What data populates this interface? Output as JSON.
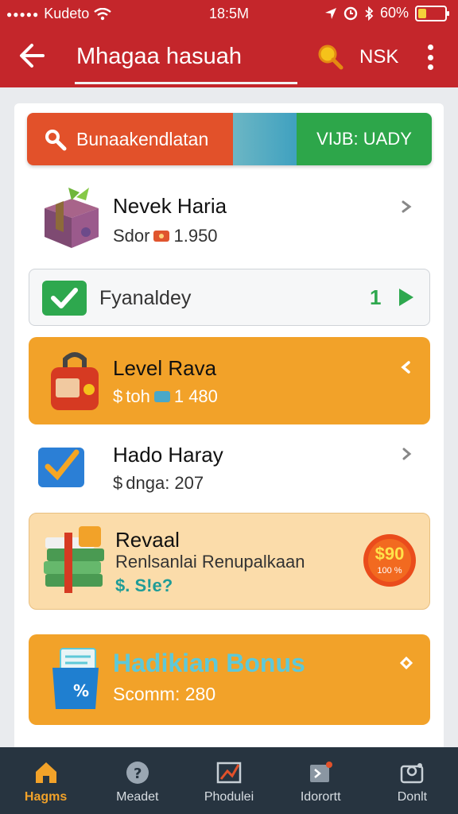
{
  "status_bar": {
    "carrier": "Kudeto",
    "time": "18:5M",
    "battery": "60%"
  },
  "header": {
    "title": "Mhagaa hasuah",
    "action_label": "NSK"
  },
  "top_bar": {
    "search_label": "Bunaakendlatan",
    "vip_label": "VIJB: UADY"
  },
  "items": [
    {
      "name": "Nevek Haria",
      "sub": "Sdor",
      "value": "1.950"
    },
    {
      "label": "Fyanaldey",
      "count": "1"
    },
    {
      "name": "Level Rava",
      "sub": "toh",
      "value": "1 480"
    },
    {
      "name": "Hado Haray",
      "sub": "dnga: 207"
    },
    {
      "name": "Revaal",
      "sub": "Renlsanlai Renupalkaan",
      "price": "S!e?",
      "badge_top": "$90",
      "badge_bottom": "100 %"
    },
    {
      "name": "Hadikian Bonus",
      "sub": "Scomm: 280"
    }
  ],
  "nav": [
    {
      "label": "Hagms",
      "icon": "home-icon"
    },
    {
      "label": "Meadet",
      "icon": "coin-icon"
    },
    {
      "label": "Phodulei",
      "icon": "chart-icon"
    },
    {
      "label": "Idorortt",
      "icon": "notification-icon"
    },
    {
      "label": "Donlt",
      "icon": "profile-icon"
    }
  ],
  "colors": {
    "header": "#c4262b",
    "orange": "#f2a229",
    "green": "#2ea84e",
    "search_orange": "#e2512a",
    "nav_bg": "#273440"
  }
}
